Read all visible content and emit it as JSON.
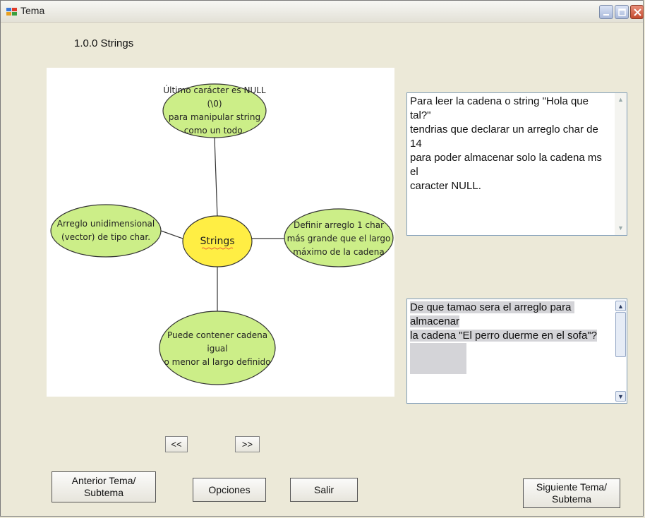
{
  "window": {
    "title": "Tema",
    "icon": "app-window-icon",
    "controls": [
      "minimize-icon",
      "maximize-icon",
      "close-icon"
    ]
  },
  "topic": {
    "label": "1.0.0  Strings"
  },
  "diagram": {
    "center": "Strings",
    "nodes": {
      "top": "Último carácter es NULL (\\0)\npara manipular string\ncomo un todo.",
      "left": "Arreglo unidimensional\n(vector) de tipo char.",
      "right": "Definir arreglo 1 char\nmás grande que el largo\nmáximo de la cadena",
      "bottom": "Puede contener cadena igual\no menor al largo definido"
    },
    "colors": {
      "outer_fill": "#CCEE88",
      "center_fill": "#FFEE44",
      "stroke": "#333333"
    }
  },
  "info_box": {
    "text": "Para leer la cadena o string \"Hola que tal?\"\ntendrias que declarar un arreglo char de 14\npara poder almacenar solo la cadena ms el\ncaracter NULL."
  },
  "question_box": {
    "line1": "De que tamao sera el arreglo para almacenar",
    "line2": "la cadena \"El perro duerme en el sofa\"?"
  },
  "nav": {
    "prev": "<<",
    "next": ">>"
  },
  "buttons": {
    "previous_topic": "Anterior Tema/\nSubtema",
    "options": "Opciones",
    "exit": "Salir",
    "next_topic": "Siguiente Tema/\nSubtema"
  }
}
